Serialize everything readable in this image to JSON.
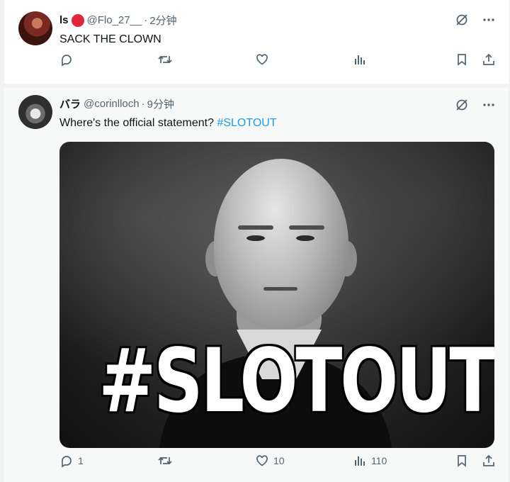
{
  "tweets": [
    {
      "name": "ls",
      "handle": "@Flo_27__",
      "dot": "·",
      "time": "2分钟",
      "text": "SACK THE CLOWN",
      "hashtag": "",
      "replies": "",
      "retweets": "",
      "likes": "",
      "views": ""
    },
    {
      "name": "バラ",
      "handle": "@corinlloch",
      "dot": "·",
      "time": "9分钟",
      "text": "Where's the official statement? ",
      "hashtag": "#SLOTOUT",
      "image_overlay_text": "#SLOTOUT",
      "replies": "1",
      "retweets": "",
      "likes": "10",
      "views": "110"
    }
  ],
  "colors": {
    "accent": "#1d9bf0",
    "muted": "#536471",
    "text": "#0f1419",
    "flag": "#e0263a"
  },
  "icons": [
    "grok-icon",
    "more-icon",
    "reply-icon",
    "retweet-icon",
    "like-icon",
    "views-icon",
    "bookmark-icon",
    "share-icon"
  ]
}
